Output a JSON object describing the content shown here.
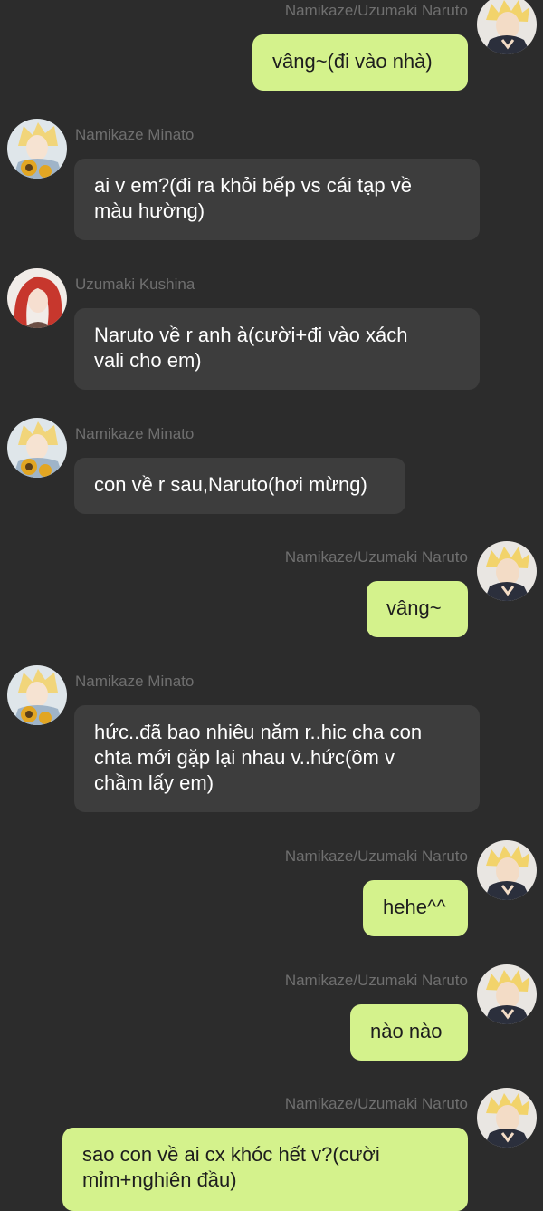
{
  "colors": {
    "background": "#2c2c2c",
    "bubble_other": "#3d3d3d",
    "bubble_self": "#d4f28c",
    "sender_name": "#6f6f6f"
  },
  "messages": [
    {
      "side": "right",
      "sender": "Namikaze/Uzumaki Naruto",
      "avatar": "naruto-avatar",
      "text": "vâng~(đi vào nhà)"
    },
    {
      "side": "left",
      "sender": "Namikaze Minato",
      "avatar": "minato-avatar",
      "text": "ai v em?(đi ra khỏi bếp vs cái tạp về\nmàu hường)"
    },
    {
      "side": "left",
      "sender": "Uzumaki Kushina",
      "avatar": "kushina-avatar",
      "text": "Naruto về r anh à(cười+đi vào xách\nvali cho em)"
    },
    {
      "side": "left",
      "sender": "Namikaze Minato",
      "avatar": "minato-avatar",
      "text": "con về r sau,Naruto(hơi mừng)"
    },
    {
      "side": "right",
      "sender": "Namikaze/Uzumaki Naruto",
      "avatar": "naruto-avatar",
      "text": "vâng~"
    },
    {
      "side": "left",
      "sender": "Namikaze Minato",
      "avatar": "minato-avatar",
      "text": "hức..đã bao nhiêu năm r..hic cha con\nchta mới gặp lại nhau v..hức(ôm v\nchầm lấy em)"
    },
    {
      "side": "right",
      "sender": "Namikaze/Uzumaki Naruto",
      "avatar": "naruto-avatar",
      "text": "hehe^^"
    },
    {
      "side": "right",
      "sender": "Namikaze/Uzumaki Naruto",
      "avatar": "naruto-avatar",
      "text": "nào nào"
    },
    {
      "side": "right",
      "sender": "Namikaze/Uzumaki Naruto",
      "avatar": "naruto-avatar",
      "text": "sao con về ai cx khóc hết v?(cười\nmỉm+nghiên đầu)"
    }
  ]
}
